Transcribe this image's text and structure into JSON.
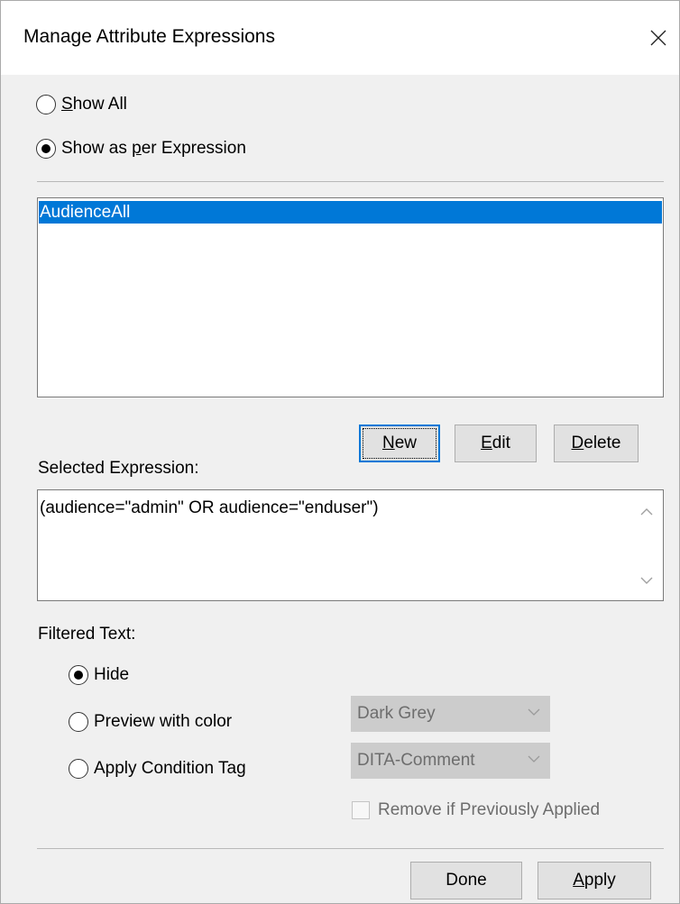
{
  "dialog": {
    "title": "Manage Attribute Expressions"
  },
  "filter_mode": {
    "show_all_label": "Show All",
    "show_all_mnemonic": "S",
    "show_as_per_expression_label_pre": "Show as ",
    "show_as_per_expression_mnemonic": "p",
    "show_as_per_expression_label_post": "er Expression",
    "selected": "show_as_per_expression"
  },
  "expressions_list": {
    "items": [
      "AudienceAll"
    ],
    "selected_index": 0
  },
  "buttons": {
    "new_label": "New",
    "new_mnemonic": "N",
    "new_rest": "ew",
    "edit_label": "Edit",
    "edit_mnemonic": "E",
    "edit_rest": "dit",
    "delete_label": "Delete",
    "delete_mnemonic": "D",
    "delete_rest": "elete",
    "done_label": "Done",
    "apply_label": "Apply",
    "apply_mnemonic": "A",
    "apply_rest": "pply"
  },
  "selected_expression": {
    "label": "Selected Expression:",
    "value": "(audience=\"admin\" OR audience=\"enduser\")"
  },
  "filtered_text": {
    "label": "Filtered Text:",
    "hide_label": "Hide",
    "preview_label": "Preview with color",
    "apply_tag_label": "Apply Condition Tag",
    "selected": "hide",
    "color_value": "Dark Grey",
    "tag_value": "DITA-Comment",
    "remove_label": "Remove if Previously Applied",
    "remove_checked": false
  },
  "colors": {
    "selection": "#0078d7",
    "disabled_text": "#6d6d6d"
  }
}
